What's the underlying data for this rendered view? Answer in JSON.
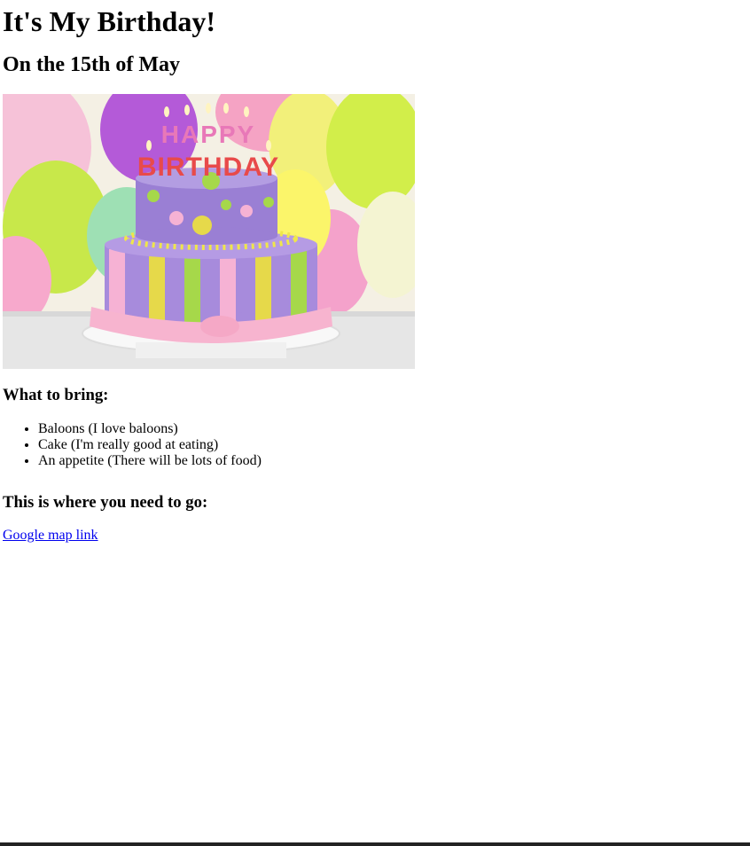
{
  "page": {
    "title": "It's My Birthday!",
    "subtitle": "On the 15th of May"
  },
  "image": {
    "description_name": "birthday-cake-photo",
    "cake_text_top": "HAPPY",
    "cake_text_bottom": "BIRTHDAY"
  },
  "bring": {
    "heading": "What to bring:",
    "items": [
      "Baloons (I love baloons)",
      "Cake (I'm really good at eating)",
      "An appetite (There will be lots of food)"
    ]
  },
  "where": {
    "heading": "This is where you need to go:",
    "link_text": "Google map link"
  },
  "colors": {
    "link": "#0000ee",
    "cake_purple": "#9b7fd6",
    "cake_pink": "#f2a9c9",
    "cake_yellow": "#e4d83a",
    "cake_green": "#9fd64a"
  }
}
